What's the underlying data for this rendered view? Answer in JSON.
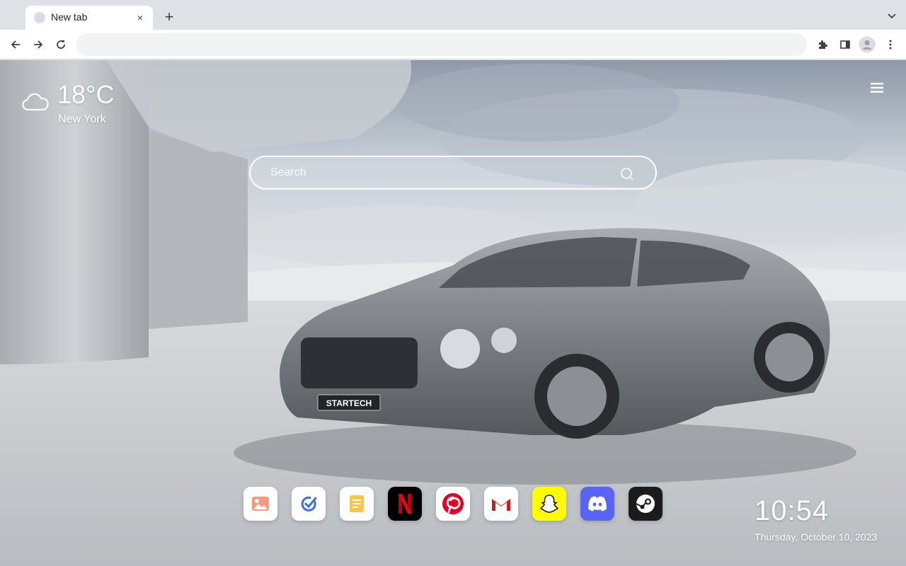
{
  "browser": {
    "tab": {
      "title": "New tab",
      "close_label": "×"
    },
    "new_tab_label": "+",
    "omnibox": {
      "value": "",
      "placeholder": ""
    },
    "icons": [
      "back-icon",
      "forward-icon",
      "reload-icon",
      "extensions-icon",
      "side-panel-icon",
      "profile-icon",
      "menu-dots-icon",
      "tab-search-icon"
    ]
  },
  "weather": {
    "temperature": "18°C",
    "city": "New York",
    "icon": "cloud-icon"
  },
  "search": {
    "placeholder": "Search",
    "value": ""
  },
  "shortcuts": [
    {
      "name": "Photos",
      "icon": "photos-icon",
      "bg": "#ffffff"
    },
    {
      "name": "Tasks",
      "icon": "check-icon",
      "bg": "#ffffff"
    },
    {
      "name": "Notes",
      "icon": "notes-icon",
      "bg": "#ffffff"
    },
    {
      "name": "Netflix",
      "icon": "netflix-icon",
      "bg": "#000000"
    },
    {
      "name": "Pinterest",
      "icon": "pinterest-icon",
      "bg": "#ffffff"
    },
    {
      "name": "Gmail",
      "icon": "gmail-icon",
      "bg": "#ffffff"
    },
    {
      "name": "Snapchat",
      "icon": "snapchat-icon",
      "bg": "#fffc00"
    },
    {
      "name": "Discord",
      "icon": "discord-icon",
      "bg": "#5865f2"
    },
    {
      "name": "Steam",
      "icon": "steam-icon",
      "bg": "#1b1b1b"
    }
  ],
  "clock": {
    "time": "10:54",
    "date": "Thursday, October 10, 2023"
  },
  "wallpaper": {
    "subject": "car-wallpaper",
    "plate_text": "STARTECH"
  },
  "colors": {
    "accent": "#ffffff",
    "netflix": "#e50914",
    "pinterest": "#e60023",
    "discord": "#5865f2",
    "snapchat": "#fffc00"
  }
}
